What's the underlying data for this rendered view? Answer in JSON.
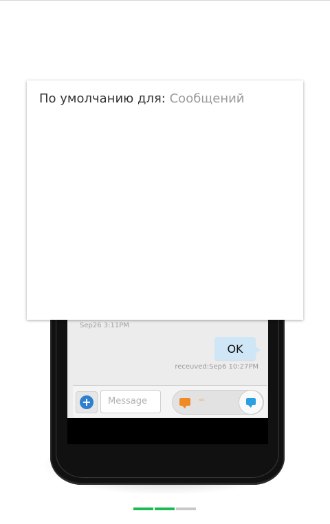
{
  "dialog": {
    "title_prefix": "По умолчанию для:",
    "title_app": "Сообщений"
  },
  "conversation": {
    "timestamp_left": "Sep26 3:11PM",
    "bubble_text": "OK",
    "timestamp_right": "receuved:Sep6 10:27PM"
  },
  "compose": {
    "add_icon": "plus-circle-icon",
    "placeholder": "Message",
    "sms_icon": "orange-chat-icon",
    "arrows": "‹‹‹",
    "imessage_icon": "blue-chat-icon"
  },
  "pager": {
    "pages": 3,
    "active": [
      1,
      2
    ],
    "colors": {
      "active": "#1db954",
      "inactive": "#c8c8c8"
    }
  }
}
